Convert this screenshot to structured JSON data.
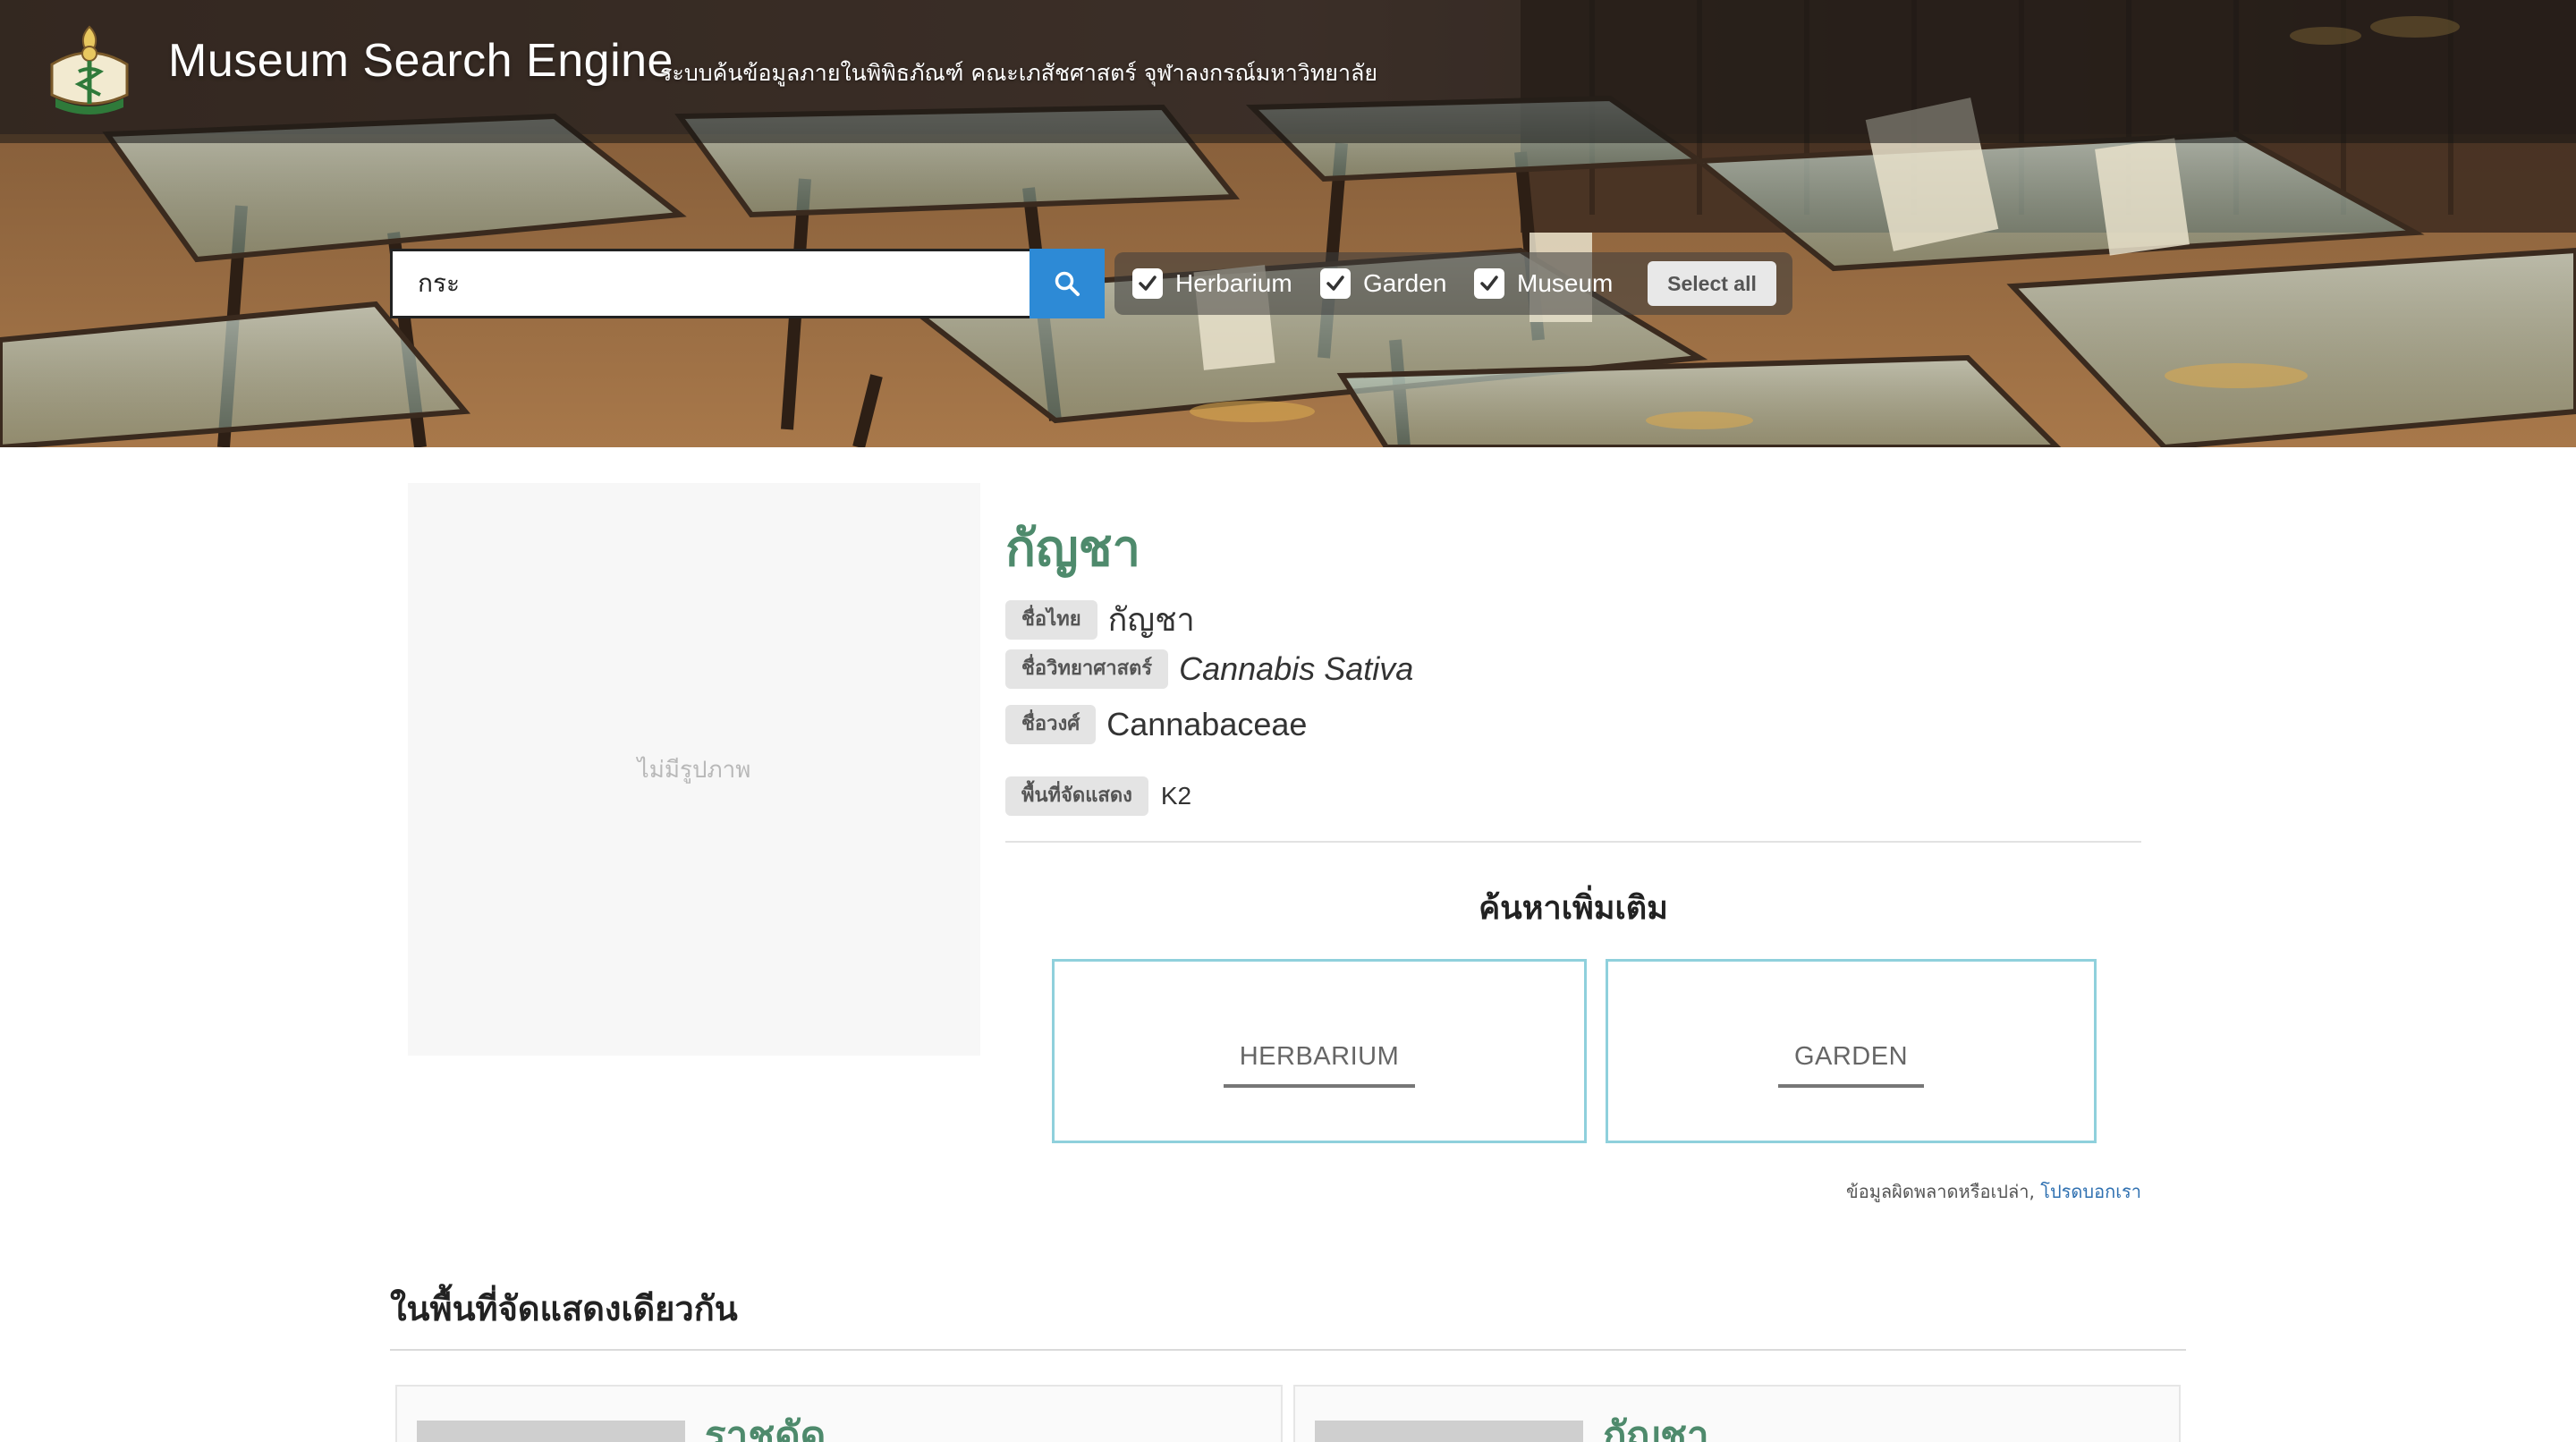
{
  "header": {
    "title": "Museum Search Engine",
    "subtitle": "ระบบค้นข้อมูลภายในพิพิธภัณฑ์ คณะเภสัชศาสตร์ จุฬาลงกรณ์มหาวิทยาลัย",
    "logo_icon": "faculty-seal-icon"
  },
  "search": {
    "value": "กระ",
    "button_icon": "search-icon",
    "filters": [
      {
        "label": "Herbarium",
        "checked": true
      },
      {
        "label": "Garden",
        "checked": true
      },
      {
        "label": "Museum",
        "checked": true
      }
    ],
    "select_all_label": "Select all"
  },
  "item": {
    "no_image_text": "ไม่มีรูปภาพ",
    "name": "กัญชา",
    "fields": {
      "thai_name_tag": "ชื่อไทย",
      "thai_name": "กัญชา",
      "sci_name_tag": "ชื่อวิทยาศาสตร์",
      "sci_name": "Cannabis Sativa",
      "family_tag": "ชื่อวงศ์",
      "family": "Cannabaceae",
      "area_tag": "พื้นที่จัดแสดง",
      "area": "K2"
    }
  },
  "more": {
    "title": "ค้นหาเพิ่มเติม",
    "links": [
      "HERBARIUM",
      "GARDEN"
    ]
  },
  "report": {
    "text": "ข้อมูลผิดพลาดหรือเปล่า,",
    "link": "โปรดบอกเรา"
  },
  "same_area": {
    "title": "ในพื้นที่จัดแสดงเดียวกัน",
    "items": [
      "ราชดัด",
      "กัญชา"
    ]
  },
  "colors": {
    "accent_green": "#4e8a6c",
    "search_button": "#2d8ad6",
    "card_border": "#8fd0dc",
    "link": "#2d6fb0"
  }
}
